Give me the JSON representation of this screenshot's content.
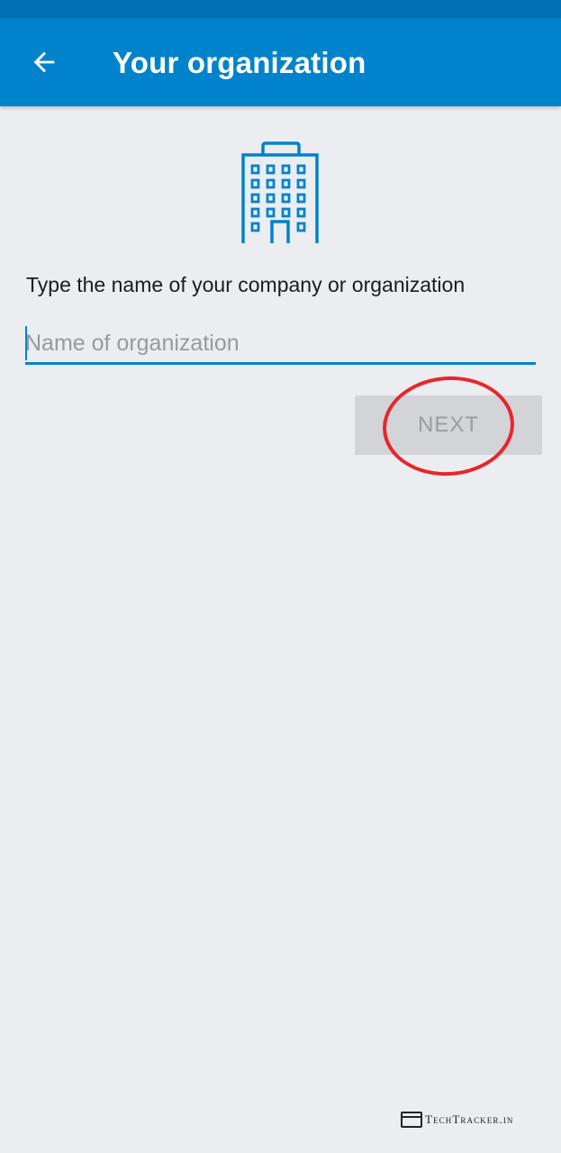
{
  "app_bar": {
    "back_icon": "arrow-left-icon",
    "title": "Your organization",
    "color": "#0083CA"
  },
  "header_icon": "office-building-icon",
  "form": {
    "prompt": "Type the name of your company or organization",
    "org_name": {
      "value": "",
      "placeholder": "Name of organization"
    },
    "next_label": "NEXT",
    "next_enabled": false
  },
  "annotation": {
    "type": "highlight-circle",
    "color": "#E8262B"
  },
  "watermark": {
    "text": "TechTracker.in"
  }
}
